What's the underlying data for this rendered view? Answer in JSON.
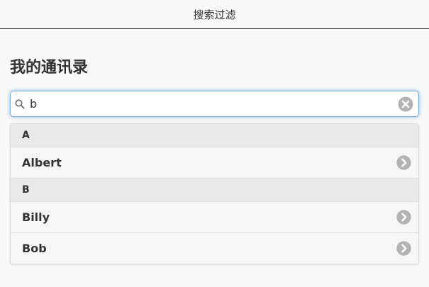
{
  "header": {
    "title": "搜索过滤"
  },
  "page": {
    "title": "我的通讯录"
  },
  "search": {
    "value": "b",
    "icon": "search-icon",
    "clear_icon": "clear-icon"
  },
  "list": {
    "groups": [
      {
        "letter": "A",
        "items": [
          {
            "name": "Albert"
          }
        ]
      },
      {
        "letter": "B",
        "items": [
          {
            "name": "Billy"
          },
          {
            "name": "Bob"
          }
        ]
      }
    ],
    "item_icon": "chevron-right-circle-icon"
  },
  "colors": {
    "background": "#f9f9f9",
    "divider_bg": "#e9e9e9",
    "row_bg": "#f6f6f6",
    "focus_glow": "#7aaee0",
    "icon_gray": "#b3b3b3"
  }
}
